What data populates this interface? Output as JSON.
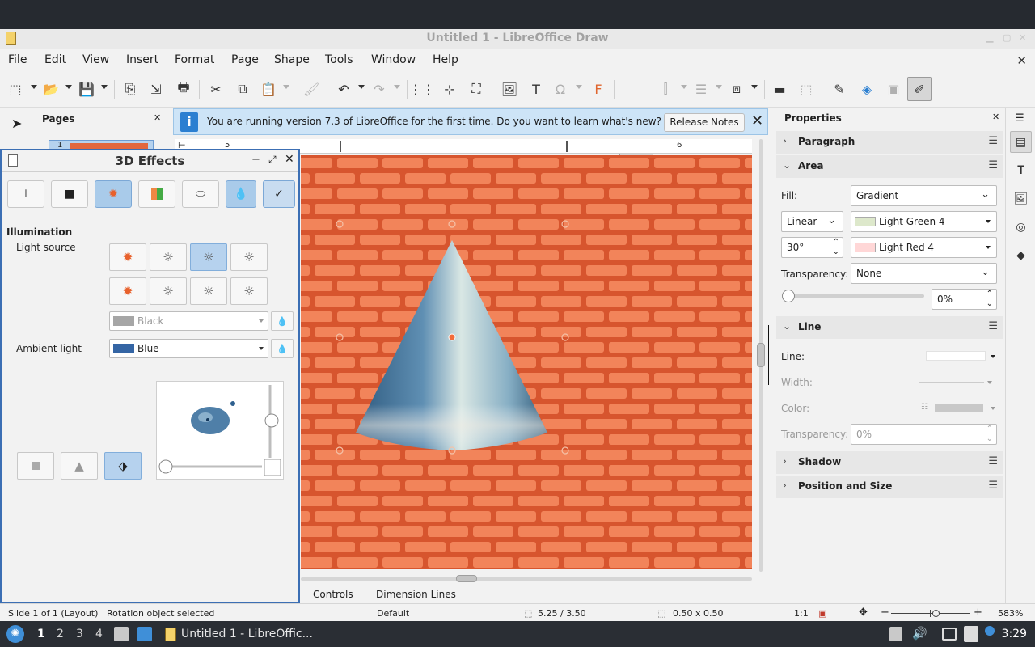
{
  "window": {
    "title": "Untitled 1 - LibreOffice Draw"
  },
  "menu": [
    "File",
    "Edit",
    "View",
    "Insert",
    "Format",
    "Page",
    "Shape",
    "Tools",
    "Window",
    "Help"
  ],
  "pages_panel": {
    "title": "Pages",
    "page_number": "1"
  },
  "infobar": {
    "message": "You are running version 7.3 of LibreOffice for the first time. Do you want to learn what's new?",
    "button": "Release Notes"
  },
  "ruler": {
    "labels": [
      "5",
      "6"
    ]
  },
  "dialog": {
    "title": "3D Effects",
    "section": "Illumination",
    "light_source_label": "Light source",
    "light_color": "Black",
    "ambient_label": "Ambient light",
    "ambient_color": "Blue",
    "colors": {
      "ambient": "#3465a4",
      "light": "#a6a6a6",
      "accent_selected": "#a9cbea"
    }
  },
  "bottom_tabs": [
    "Controls",
    "Dimension Lines"
  ],
  "sidebar": {
    "title": "Properties",
    "sections": {
      "paragraph": "Paragraph",
      "area": "Area",
      "line": "Line",
      "shadow": "Shadow",
      "position": "Position and Size"
    },
    "area": {
      "fill_label": "Fill:",
      "fill_value": "Gradient",
      "gradient_type": "Linear",
      "color1": "Light Green 4",
      "color1_hex": "#dde8cb",
      "angle": "30°",
      "color2": "Light Red 4",
      "color2_hex": "#ffd7d7",
      "transparency_label": "Transparency:",
      "transparency_value": "None",
      "transparency_percent": "0%"
    },
    "line": {
      "line_label": "Line:",
      "width_label": "Width:",
      "color_label": "Color:",
      "transparency_label": "Transparency:",
      "transparency_value": "0%"
    }
  },
  "status": {
    "slide": "Slide 1 of 1 (Layout)",
    "selection": "Rotation object selected",
    "layout": "Default",
    "position": "5.25 / 3.50",
    "size": "0.50 x 0.50",
    "scale": "1:1",
    "zoom": "583%"
  },
  "taskbar": {
    "workspaces": [
      "1",
      "2",
      "3",
      "4"
    ],
    "app": "Untitled 1 - LibreOffic...",
    "clock": "3:29"
  }
}
